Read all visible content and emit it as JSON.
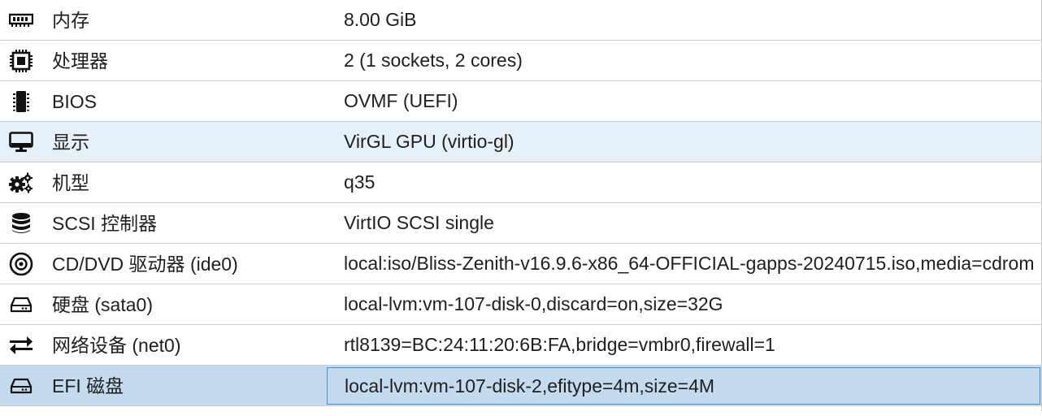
{
  "hardware": {
    "rows": [
      {
        "key": "内存",
        "value": "8.00 GiB",
        "icon": "memory-icon"
      },
      {
        "key": "处理器",
        "value": "2 (1 sockets, 2 cores)",
        "icon": "cpu-icon"
      },
      {
        "key": "BIOS",
        "value": "OVMF (UEFI)",
        "icon": "chip-icon"
      },
      {
        "key": "显示",
        "value": "VirGL GPU (virtio-gl)",
        "icon": "monitor-icon"
      },
      {
        "key": "机型",
        "value": "q35",
        "icon": "gears-icon"
      },
      {
        "key": "SCSI 控制器",
        "value": "VirtIO SCSI single",
        "icon": "database-icon"
      },
      {
        "key": "CD/DVD 驱动器 (ide0)",
        "value": "local:iso/Bliss-Zenith-v16.9.6-x86_64-OFFICIAL-gapps-20240715.iso,media=cdrom",
        "icon": "cdrom-icon"
      },
      {
        "key": "硬盘 (sata0)",
        "value": "local-lvm:vm-107-disk-0,discard=on,size=32G",
        "icon": "harddisk-icon"
      },
      {
        "key": "网络设备 (net0)",
        "value": "rtl8139=BC:24:11:20:6B:FA,bridge=vmbr0,firewall=1",
        "icon": "exchange-arrows-icon"
      },
      {
        "key": "EFI 磁盘",
        "value": "local-lvm:vm-107-disk-2,efitype=4m,size=4M",
        "icon": "harddisk-icon"
      }
    ],
    "hover_row": 3,
    "selected_row": 9,
    "colors": {
      "hover": "#e6f0f8",
      "selected": "#c4dbef",
      "focus_border": "#4a8ccd"
    }
  }
}
